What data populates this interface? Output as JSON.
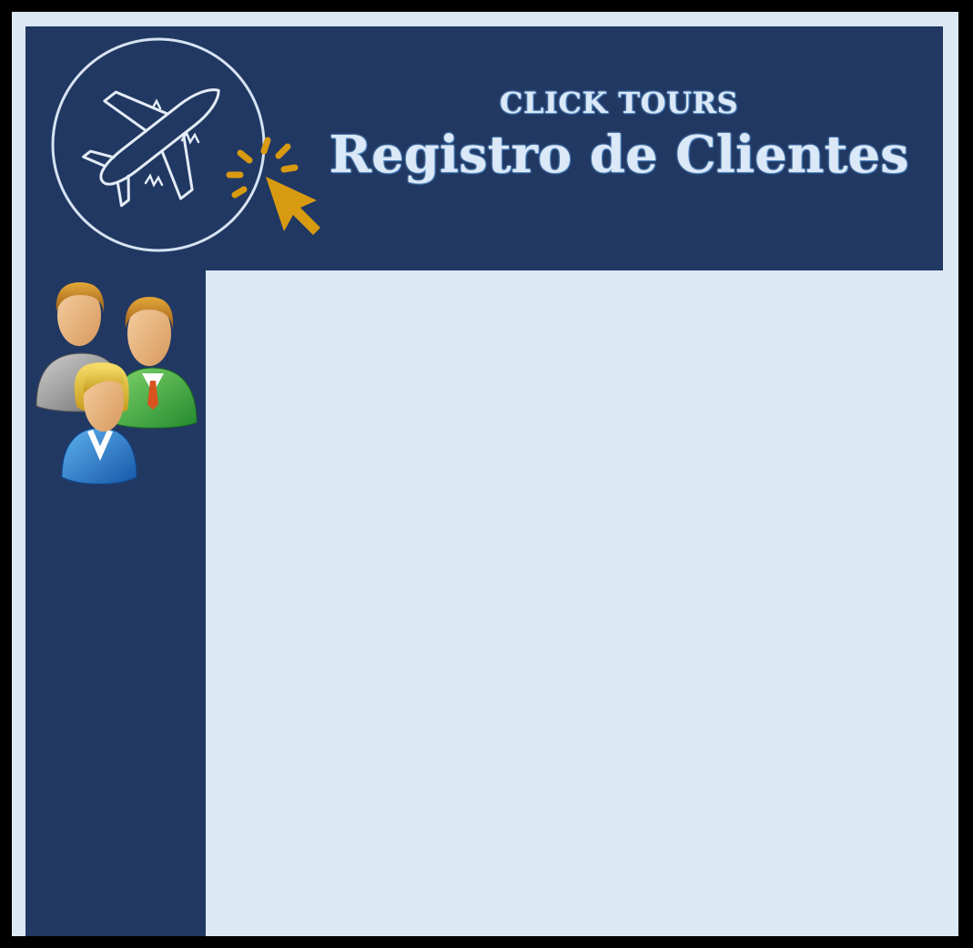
{
  "header": {
    "company": "CLICK TOURS",
    "title": "Registro de Clientes",
    "logo_icon": "airplane-click-icon",
    "accent_color": "#d89a10"
  },
  "sidebar": {
    "icon": "users-group-icon"
  },
  "colors": {
    "navy": "#213863",
    "light_panel": "#dde8f5",
    "outer_border": "#000000"
  }
}
